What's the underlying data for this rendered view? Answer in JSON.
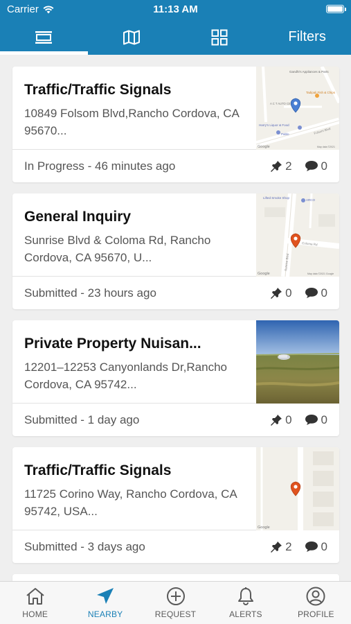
{
  "status_bar": {
    "carrier": "Carrier",
    "time": "11:13 AM"
  },
  "toolbar": {
    "items": [
      {
        "icon": "list-view-icon",
        "active": true
      },
      {
        "icon": "map-view-icon"
      },
      {
        "icon": "grid-view-icon"
      }
    ],
    "filters_label": "Filters"
  },
  "requests": [
    {
      "title": "Traffic/Traffic Signals",
      "address": "10849 Folsom Blvd,Rancho Cordova, CA 95670...",
      "status": "In Progress - 46 minutes ago",
      "pins": "2",
      "comments": "0",
      "thumb": "map",
      "pin_color": "#4a7fd3"
    },
    {
      "title": "General Inquiry",
      "address": "Sunrise Blvd & Coloma Rd, Rancho Cordova, CA 95670, U...",
      "status": "Submitted - 23 hours ago",
      "pins": "0",
      "comments": "0",
      "thumb": "map",
      "pin_color": "#e0531f"
    },
    {
      "title": "Private Property Nuisan...",
      "address": "12201–12253 Canyonlands Dr,Rancho Cordova, CA 95742...",
      "status": "Submitted - 1 day ago",
      "pins": "0",
      "comments": "0",
      "thumb": "photo"
    },
    {
      "title": "Traffic/Traffic Signals",
      "address": "11725 Corino Way, Rancho Cordova, CA 95742, USA...",
      "status": "Submitted - 3 days ago",
      "pins": "2",
      "comments": "0",
      "thumb": "map",
      "pin_color": "#e0531f"
    }
  ],
  "map_labels": {
    "m1_a": "Gandhi's Appliances & Parts",
    "m1_b": "Tadipali Fish & Chips",
    "m1_c": "A C T AUTO CENTER",
    "m1_d": "Harry's Liquor & Food",
    "m1_e": "Folsom Blvd",
    "m1_f": "Pablo",
    "m2_a": "Lifted Smoke Shop",
    "m2_b": "ARCO",
    "m2_c": "Coloma Rd",
    "m2_d": "Sunrise Blvd",
    "google": "Google",
    "m1_copyright": "Map data ©2021",
    "m2_copyright": "Map data ©2021 Google"
  },
  "tabbar": [
    {
      "label": "HOME",
      "icon": "home-icon"
    },
    {
      "label": "NEARBY",
      "icon": "nearby-arrow-icon",
      "active": true
    },
    {
      "label": "REQUEST",
      "icon": "add-circle-icon"
    },
    {
      "label": "ALERTS",
      "icon": "bell-icon"
    },
    {
      "label": "PROFILE",
      "icon": "profile-icon"
    }
  ],
  "colors": {
    "brand": "#1a80b6",
    "background": "#efefef",
    "pin_blue": "#4a7fd3",
    "pin_orange": "#e0531f"
  }
}
